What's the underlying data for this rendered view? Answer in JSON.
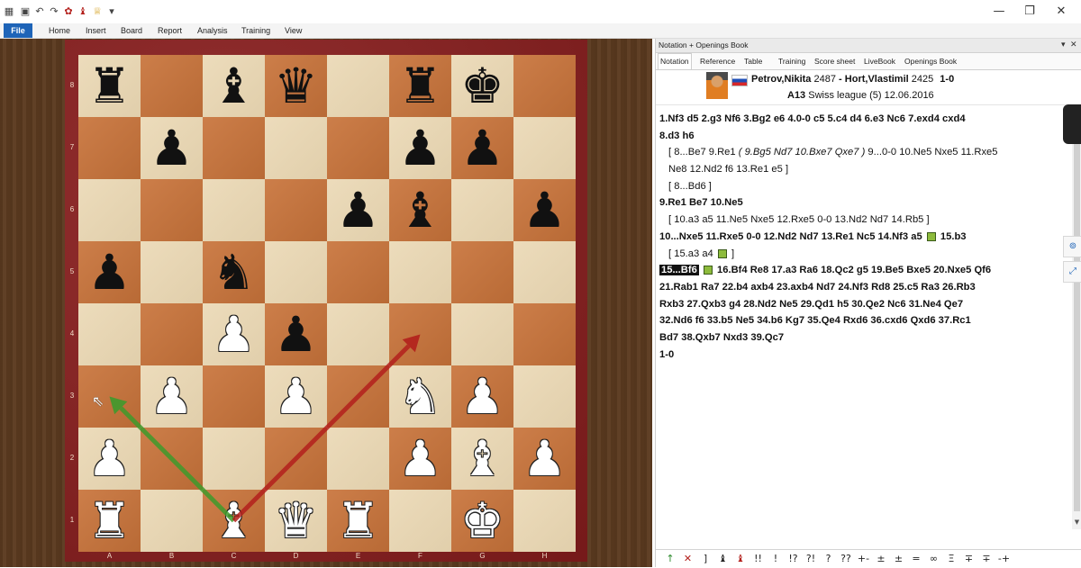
{
  "quick_access": [
    "grid-icon",
    "save-icon",
    "undo-icon",
    "redo-icon",
    "engine-icon",
    "bishop-icon",
    "trophy-icon",
    "dropdown-icon"
  ],
  "window_controls": {
    "minimize": "—",
    "maximize": "❐",
    "close": "✕"
  },
  "menu": {
    "file": "File",
    "items": [
      "Home",
      "Insert",
      "Board",
      "Report",
      "Analysis",
      "Training",
      "View"
    ]
  },
  "board": {
    "ranks": [
      "8",
      "7",
      "6",
      "5",
      "4",
      "3",
      "2",
      "1"
    ],
    "files": [
      "A",
      "B",
      "C",
      "D",
      "E",
      "F",
      "G",
      "H"
    ],
    "pieces": [
      {
        "square": "a8",
        "color": "black",
        "type": "rook",
        "glyph": "♜"
      },
      {
        "square": "c8",
        "color": "black",
        "type": "bishop",
        "glyph": "♝"
      },
      {
        "square": "d8",
        "color": "black",
        "type": "queen",
        "glyph": "♛"
      },
      {
        "square": "f8",
        "color": "black",
        "type": "rook",
        "glyph": "♜"
      },
      {
        "square": "g8",
        "color": "black",
        "type": "king",
        "glyph": "♚"
      },
      {
        "square": "b7",
        "color": "black",
        "type": "pawn",
        "glyph": "♟"
      },
      {
        "square": "f7",
        "color": "black",
        "type": "pawn",
        "glyph": "♟"
      },
      {
        "square": "g7",
        "color": "black",
        "type": "pawn",
        "glyph": "♟"
      },
      {
        "square": "e6",
        "color": "black",
        "type": "pawn",
        "glyph": "♟"
      },
      {
        "square": "f6",
        "color": "black",
        "type": "bishop",
        "glyph": "♝"
      },
      {
        "square": "h6",
        "color": "black",
        "type": "pawn",
        "glyph": "♟"
      },
      {
        "square": "a5",
        "color": "black",
        "type": "pawn",
        "glyph": "♟"
      },
      {
        "square": "c5",
        "color": "black",
        "type": "knight",
        "glyph": "♞"
      },
      {
        "square": "c4",
        "color": "white",
        "type": "pawn",
        "glyph": "♟"
      },
      {
        "square": "d4",
        "color": "black",
        "type": "pawn",
        "glyph": "♟"
      },
      {
        "square": "b3",
        "color": "white",
        "type": "pawn",
        "glyph": "♟"
      },
      {
        "square": "d3",
        "color": "white",
        "type": "pawn",
        "glyph": "♟"
      },
      {
        "square": "f3",
        "color": "white",
        "type": "knight",
        "glyph": "♞"
      },
      {
        "square": "g3",
        "color": "white",
        "type": "pawn",
        "glyph": "♟"
      },
      {
        "square": "a2",
        "color": "white",
        "type": "pawn",
        "glyph": "♟"
      },
      {
        "square": "f2",
        "color": "white",
        "type": "pawn",
        "glyph": "♟"
      },
      {
        "square": "g2",
        "color": "white",
        "type": "bishop",
        "glyph": "♝"
      },
      {
        "square": "h2",
        "color": "white",
        "type": "pawn",
        "glyph": "♟"
      },
      {
        "square": "a1",
        "color": "white",
        "type": "rook",
        "glyph": "♜"
      },
      {
        "square": "c1",
        "color": "white",
        "type": "bishop",
        "glyph": "♝"
      },
      {
        "square": "d1",
        "color": "white",
        "type": "queen",
        "glyph": "♛"
      },
      {
        "square": "e1",
        "color": "white",
        "type": "rook",
        "glyph": "♜"
      },
      {
        "square": "g1",
        "color": "white",
        "type": "king",
        "glyph": "♚"
      }
    ],
    "arrows": [
      {
        "from": "c1",
        "to": "a3",
        "color": "#3e9a2c"
      },
      {
        "from": "c1",
        "to": "f4",
        "color": "#b3201c"
      }
    ],
    "colors": {
      "light": "#ead7b2",
      "dark": "#c8733a",
      "frame": "#8a1e1e"
    }
  },
  "panel": {
    "title": "Notation + Openings Book",
    "tabs": [
      "Notation",
      "Reference",
      "Table",
      "Training",
      "Score sheet",
      "LiveBook",
      "Openings Book"
    ],
    "white_player": "Petrov,Nikita",
    "white_elo": "2487",
    "separator": "-",
    "black_player": "Hort,Vlastimil",
    "black_elo": "2425",
    "result": "1-0",
    "eco": "A13",
    "event": "Swiss league (5) 12.06.2016"
  },
  "notation": {
    "l1": "1.Nf3  d5  2.g3  Nf6  3.Bg2  e6  4.0-0  c5  5.c4  d4  6.e3  Nc6  7.exd4  cxd4",
    "l2": "8.d3  h6",
    "l3a": "[ 8...Be7  9.Re1  ",
    "l3b": "( 9.Bg5  Nd7  10.Bxe7  Qxe7 )",
    "l3c": " 9...0-0  10.Ne5  Nxe5  11.Rxe5",
    "l4": "Ne8  12.Nd2  f6  13.Re1  e5 ]",
    "l5": "[ 8...Bd6 ]",
    "l6": "9.Re1  Be7  10.Ne5",
    "l7": "[ 10.a3  a5  11.Ne5  Nxe5  12.Rxe5  0-0  13.Nd2  Nd7  14.Rb5 ]",
    "l8": "10...Nxe5  11.Rxe5  0-0  12.Nd2  Nd7  13.Re1  Nc5  14.Nf3  a5",
    "l8b": " 15.b3",
    "l9": "[ 15.a3  a4",
    "l9b": " ]",
    "l10hl": "15...Bf6",
    "l10": "  16.Bf4  Re8  17.a3  Ra6  18.Qc2  g5  19.Be5  Bxe5  20.Nxe5  Qf6",
    "l11": "21.Rab1  Ra7  22.b4  axb4  23.axb4  Nd7  24.Nf3  Rd8  25.c5  Ra3  26.Rb3",
    "l12": "Rxb3  27.Qxb3  g4  28.Nd2  Ne5  29.Qd1  h5  30.Qe2  Nc6  31.Ne4  Qe7",
    "l13": "32.Nd6  f6  33.b5  Ne5  34.b6  Kg7  35.Qe4  Rxd6  36.cxd6  Qxd6  37.Rc1",
    "l14": "Bd7  38.Qxb7  Nxd3  39.Qc7",
    "l15": "1-0"
  },
  "annotation_symbols": [
    "↑",
    "✕",
    "]",
    "♝",
    "♝",
    "!!",
    "!",
    "!?",
    "?!",
    "?",
    "??",
    "+-",
    "±",
    "±",
    "=",
    "∞",
    "Ξ",
    "∓",
    "∓",
    "-+"
  ]
}
